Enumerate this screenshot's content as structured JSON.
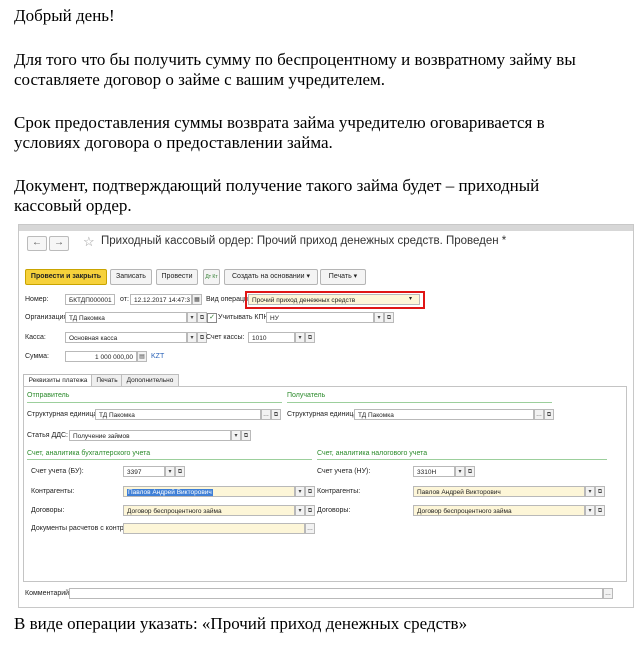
{
  "text": {
    "greeting": "Добрый день!",
    "para1_line1": "Для того что бы получить сумму по беспроцентному и возвратному займу вы",
    "para1_line2": "составляете договор о займе с вашим учредителем.",
    "para2_line1": "Срок предоставления суммы возврата  займа учредителю оговаривается в",
    "para2_line2": "условиях договора о предоставлении займа.",
    "para3_line1": "Документ, подтверждающий получение такого займа будет – приходный",
    "para3_line2": "кассовый ордер.",
    "footer": "В виде операции указать: «Прочий приход денежных средств»"
  },
  "window": {
    "back": "←",
    "forward": "→",
    "star": "☆",
    "title": "Приходный кассовый ордер: Прочий приход денежных средств. Проведен *"
  },
  "toolbar": {
    "post_close": "Провести и закрыть",
    "save": "Записать",
    "post": "Провести",
    "dt_kt": "Дт Кт",
    "create_based": "Создать на основании ▾",
    "print": "Печать ▾"
  },
  "form": {
    "number_label": "Номер:",
    "number": "БКТДП000001",
    "from_label": "от:",
    "date": "12.12.2017 14:47:3",
    "operation_label": "Вид операции:",
    "operation": "Прочий приход денежных средств",
    "org_label": "Организация:",
    "org": "ТД Пакомка",
    "kpn_label": "Учитывать КПН",
    "kpn": "НУ",
    "kassa_label": "Касса:",
    "kassa": "Основная касса",
    "account_label": "Счет кассы:",
    "account": "1010",
    "sum_label": "Сумма:",
    "sum": "1 000 000,00",
    "currency": "KZT"
  },
  "tabs": [
    "Реквизиты платежа",
    "Печать",
    "Дополнительно"
  ],
  "details": {
    "sender_title": "Отправитель",
    "receiver_title": "Получатель",
    "struct_unit_label": "Структурная единица:",
    "sender_unit": "ТД Пакомка",
    "receiver_unit": "ТД Пакомка",
    "dds_label": "Статья ДДС:",
    "dds": "Получение займов",
    "bu_title": "Счет, аналитика бухгалтерского учета",
    "nu_title": "Счет, аналитика налогового учета",
    "bu_account_label": "Счет учета (БУ):",
    "bu_account": "3397",
    "nu_account_label": "Счет учета (НУ):",
    "nu_account": "3310Н",
    "counterparty_label": "Контрагенты:",
    "counterparty_bu": "Павлов Андрей Викторович",
    "counterparty_nu": "Павлов Андрей Викторович",
    "contract_label": "Договоры:",
    "contract_bu": "Договор беспроцентного займа",
    "contract_nu": "Договор беспроцентного займа",
    "docs_label": "Документы расчетов с контр..."
  },
  "comment_label": "Комментарий:",
  "colors": {
    "primary_button": "#f6d13b",
    "highlight_box": "#e01515",
    "section_green": "#2a8a2a",
    "selection": "#3f7fd6"
  }
}
